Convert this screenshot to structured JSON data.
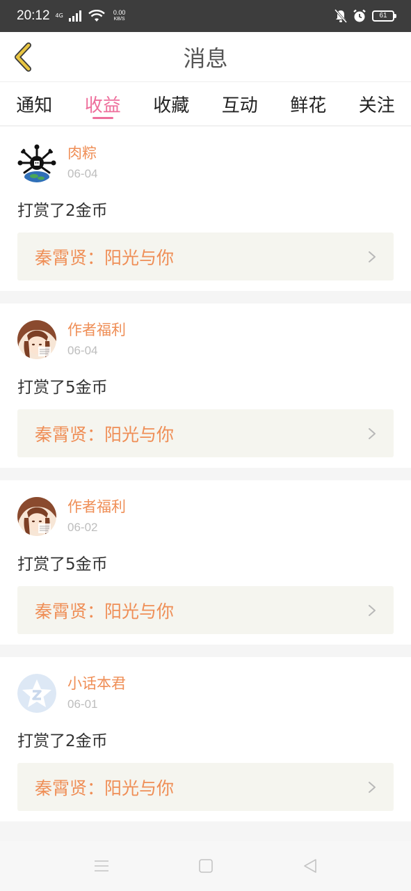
{
  "status_bar": {
    "time": "20:12",
    "network": "4G",
    "speed_value": "0.00",
    "speed_unit": "KB/S",
    "battery": "61"
  },
  "header": {
    "title": "消息",
    "back_icon": "chevron-left-icon"
  },
  "tabs": [
    {
      "label": "通知",
      "active": false
    },
    {
      "label": "收益",
      "active": true
    },
    {
      "label": "收藏",
      "active": false
    },
    {
      "label": "互动",
      "active": false
    },
    {
      "label": "鲜花",
      "active": false
    },
    {
      "label": "关注",
      "active": false
    }
  ],
  "messages": [
    {
      "sender": "肉粽",
      "date": "06-04",
      "text": "打赏了2金币",
      "link": "秦霄贤：阳光与你",
      "avatar": "earth-creature-avatar"
    },
    {
      "sender": "作者福利",
      "date": "06-04",
      "text": "打赏了5金币",
      "link": "秦霄贤：阳光与你",
      "avatar": "anime-girl-avatar"
    },
    {
      "sender": "作者福利",
      "date": "06-02",
      "text": "打赏了5金币",
      "link": "秦霄贤：阳光与你",
      "avatar": "anime-girl-avatar"
    },
    {
      "sender": "小话本君",
      "date": "06-01",
      "text": "打赏了2金币",
      "link": "秦霄贤：阳光与你",
      "avatar": "default-star-avatar"
    }
  ],
  "colors": {
    "accent_pink": "#ee6f9c",
    "accent_orange": "#ef8e56",
    "status_bar": "#3d3d3d",
    "back_arrow": "#e8c542"
  }
}
